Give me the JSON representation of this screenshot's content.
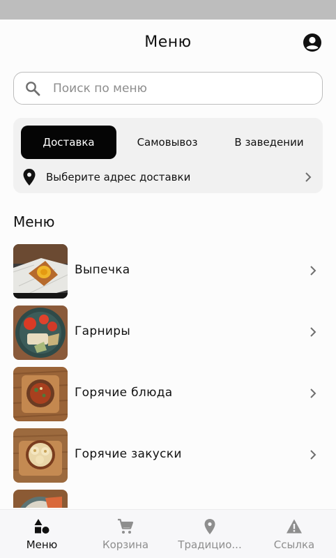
{
  "header": {
    "title": "Меню"
  },
  "search": {
    "placeholder": "Поиск по меню",
    "value": ""
  },
  "delivery": {
    "tabs": [
      {
        "label": "Доставка",
        "active": true
      },
      {
        "label": "Самовывоз",
        "active": false
      },
      {
        "label": "В заведении",
        "active": false
      }
    ],
    "address_prompt": "Выберите адрес доставки"
  },
  "menu": {
    "section_title": "Меню",
    "items": [
      {
        "label": "Выпечка",
        "image": "pastry-photo"
      },
      {
        "label": "Гарниры",
        "image": "side-dish-photo"
      },
      {
        "label": "Горячие блюда",
        "image": "hot-dish-photo"
      },
      {
        "label": "Горячие закуски",
        "image": "hot-snack-photo"
      },
      {
        "label": "",
        "image": "partial-photo"
      }
    ]
  },
  "tabbar": {
    "items": [
      {
        "label": "Меню",
        "icon": "shapes-icon",
        "active": true
      },
      {
        "label": "Корзина",
        "icon": "cart-icon",
        "active": false
      },
      {
        "label": "Традицио...",
        "icon": "location-pin-icon",
        "active": false
      },
      {
        "label": "Ссылка",
        "icon": "warning-icon",
        "active": false
      }
    ]
  },
  "colors": {
    "accent": "#050505",
    "inactive": "#8e8e8e",
    "panel": "#f1f1f1",
    "background": "#fcfcfc"
  }
}
